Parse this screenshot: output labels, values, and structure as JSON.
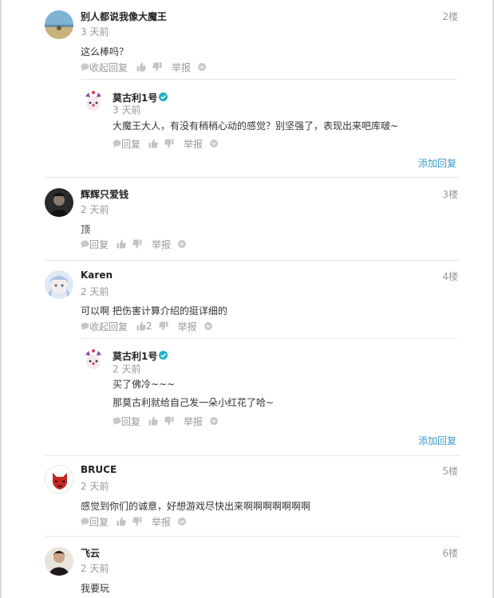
{
  "comments": [
    {
      "username": "别人都说我像大魔王",
      "date": "3 天前",
      "floor": "2楼",
      "text": "这么棒吗？",
      "reply_label": "收起回复",
      "report_label": "举报",
      "replies": [
        {
          "username": "莫古利1号",
          "date": "3 天前",
          "lines": [
            "大魔王大人，有没有稍稍心动的感觉？别坚强了，表现出来吧库啵~"
          ],
          "reply_label": "回复",
          "report_label": "举报"
        }
      ],
      "add_reply": "添加回复"
    },
    {
      "username": "辉辉只爱钱",
      "date": "2 天前",
      "floor": "3楼",
      "text": "顶",
      "reply_label": "回复",
      "report_label": "举报"
    },
    {
      "username": "Karen",
      "date": "2 天前",
      "floor": "4楼",
      "text": "可以啊 把伤害计算介绍的挺详细的",
      "reply_label": "收起回复",
      "like_count": "2",
      "report_label": "举报",
      "replies": [
        {
          "username": "莫古利1号",
          "date": "2 天前",
          "lines": [
            "买了佛冷~~~",
            "那莫古利就给自己发一朵小红花了哈~"
          ],
          "reply_label": "回复",
          "report_label": "举报"
        }
      ],
      "add_reply": "添加回复"
    },
    {
      "username": "BRUCE",
      "date": "2 天前",
      "floor": "5楼",
      "text": "感觉到你们的诚意，好想游戏尽快出来啊啊啊啊啊啊啊",
      "reply_label": "回复",
      "report_label": "举报"
    },
    {
      "username": "飞云",
      "date": "2 天前",
      "floor": "6楼",
      "text": "我要玩"
    }
  ],
  "colors": {
    "link": "#3b9bd1",
    "verified_badge": "#1fb0c8",
    "muted_text": "#999999",
    "divider": "#e8e8e8"
  },
  "icons": {
    "reply": "speech-bubble-icon",
    "like": "thumbs-up-icon",
    "dislike": "thumbs-down-icon",
    "more": "chevron-down-circle-icon",
    "verified": "verified-check-icon"
  }
}
